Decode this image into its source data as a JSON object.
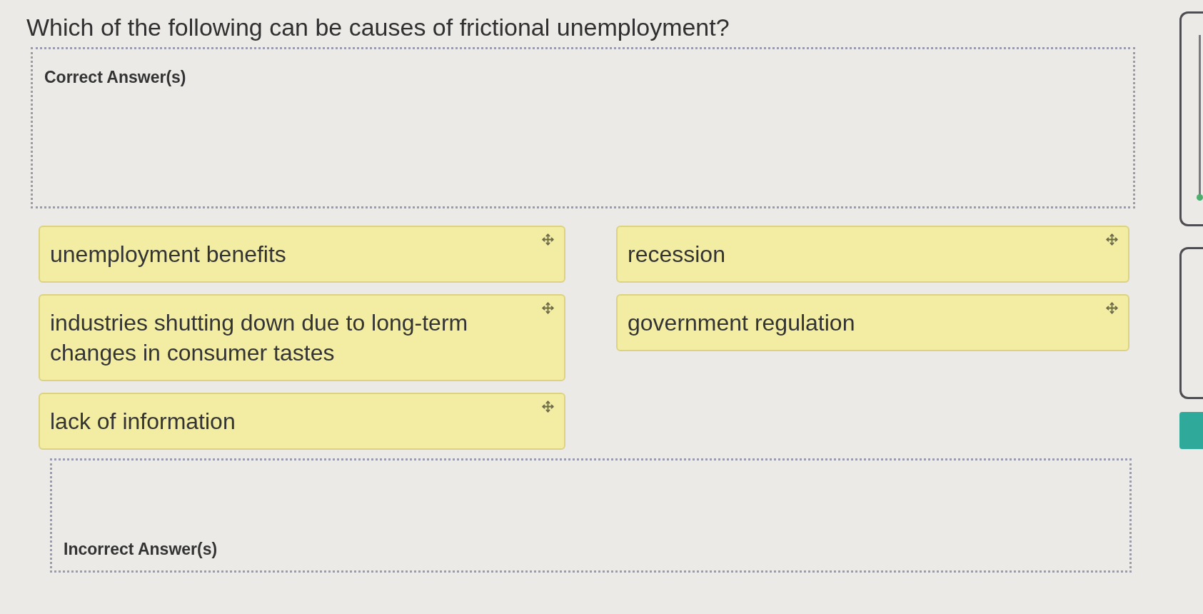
{
  "question": {
    "text": "Which of the following can be causes of frictional unemployment?"
  },
  "correct_zone": {
    "label": "Correct Answer(s)"
  },
  "choice_columns": [
    {
      "choices": [
        {
          "text": "unemployment benefits"
        },
        {
          "text": "industries shutting down due to long-term changes in consumer tastes"
        },
        {
          "text": "lack of information"
        }
      ]
    },
    {
      "choices": [
        {
          "text": "recession"
        },
        {
          "text": "government regulation"
        }
      ]
    }
  ],
  "incorrect_zone": {
    "label": "Incorrect Answer(s)"
  }
}
